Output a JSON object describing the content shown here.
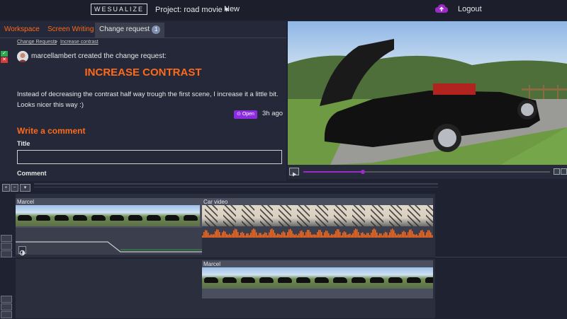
{
  "header": {
    "logo": "WESUALIZE",
    "project": "Project: road movie ▾",
    "new_label": "New",
    "logout_label": "Logout",
    "upload_icon": "cloud-upload-icon",
    "accent": "#9b2cc7"
  },
  "tabs": [
    {
      "label": "Workspace"
    },
    {
      "label": "Screen Writing"
    },
    {
      "label": "Change request",
      "badge": "1"
    }
  ],
  "breadcrumb": {
    "items": [
      "Change Requests",
      "Increase contrast"
    ],
    "separator": ">"
  },
  "change_request": {
    "creator_text": "marcellambert created the change request:",
    "title": "INCREASE CONTRAST",
    "description": "Instead of decreasing the contrast half way trough the first scene, I increase it a little bit. Looks nicer this way :)",
    "status": "Open",
    "time_ago": "3h ago",
    "accept_icon": "check-icon",
    "reject_icon": "close-icon"
  },
  "comment_form": {
    "heading": "Write a comment",
    "title_label": "Title",
    "title_value": "",
    "comment_label": "Comment"
  },
  "player": {
    "progress_fraction": 0.24,
    "play_icon": "play-icon",
    "volume_icon": "volume-icon",
    "fullscreen_icon": "fullscreen-icon"
  },
  "timeline": {
    "zoom_in_icon": "zoom-in-icon",
    "zoom_out_icon": "zoom-out-icon",
    "menu_icon": "dropdown-icon",
    "tracks": [
      {
        "clips": [
          {
            "label": "Marcel"
          },
          {
            "label": "Car video"
          }
        ]
      },
      {
        "clips": [
          {
            "label": "Marcel"
          }
        ]
      }
    ]
  },
  "colors": {
    "orange": "#ff6a1a",
    "purple": "#9b2cc7",
    "background": "#1f2230",
    "panel": "#242838"
  }
}
